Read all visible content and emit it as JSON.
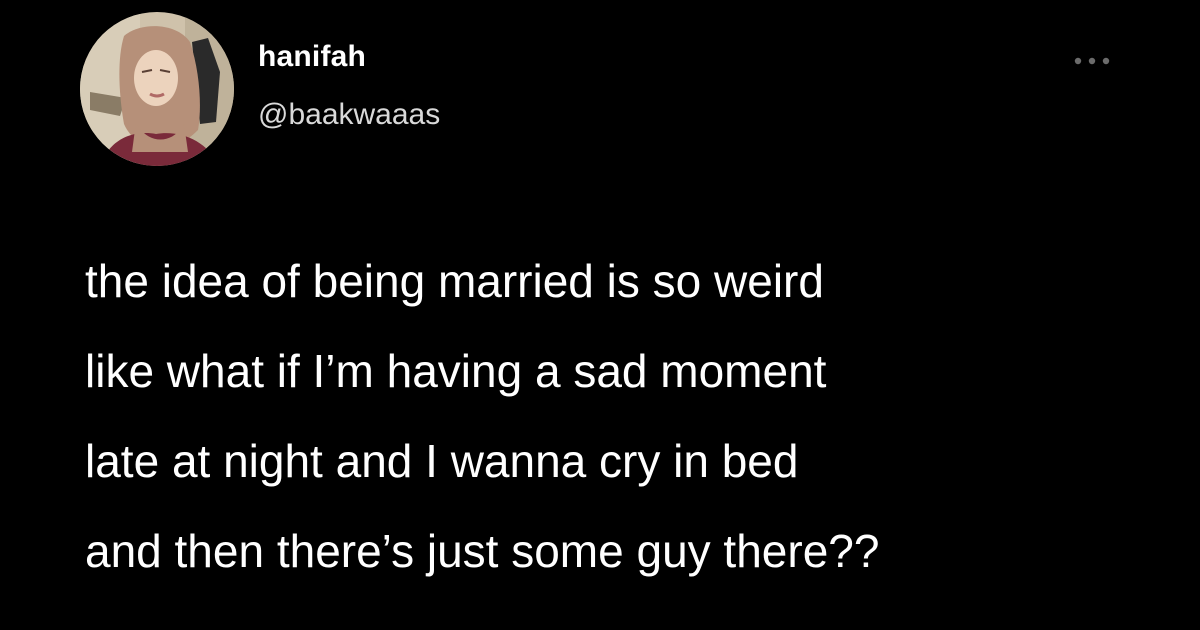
{
  "colors": {
    "background": "#000000",
    "text": "#ffffff",
    "handle_text": "#d9d9d9",
    "more_icon": "#6b6b6b"
  },
  "author": {
    "display_name": "hanifah",
    "handle": "@baakwaaas",
    "avatar_icon": "profile-photo"
  },
  "more_menu": {
    "icon": "more-dots-icon"
  },
  "tweet": {
    "lines": [
      "the idea of being married is so weird",
      "like what if I’m having a sad moment",
      "late at night and I wanna cry in bed",
      "and then there’s just some guy there??"
    ]
  }
}
